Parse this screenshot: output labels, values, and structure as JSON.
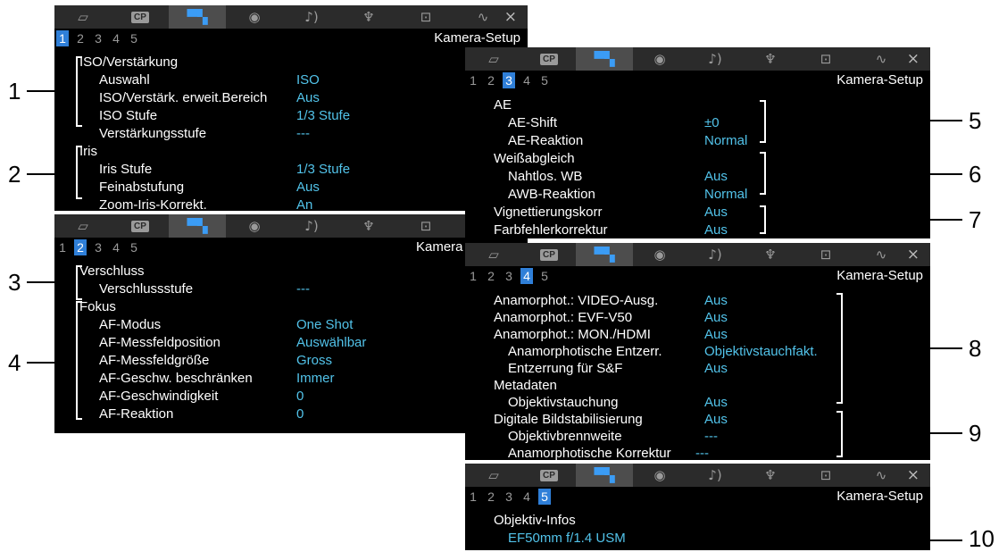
{
  "icons": [
    "frame-icon",
    "cp-icon",
    "camera-icon",
    "color-wheel-icon",
    "audio-icon",
    "wrench-icon",
    "custom-icon",
    "wave-icon",
    "close-icon"
  ],
  "cp_label": "CP",
  "close_glyph": "×",
  "selected_icon": "camera-icon",
  "page_title": "Kamera-Setup",
  "tab_numbers": [
    "1",
    "2",
    "3",
    "4",
    "5"
  ],
  "panels": {
    "p1": {
      "selected_tab": "1",
      "title": "Kamera-Setup",
      "groups": [
        {
          "label": "ISO/Verstärkung",
          "items": [
            {
              "label": "Auswahl",
              "value": "ISO"
            },
            {
              "label": "ISO/Verstärk. erweit.Bereich",
              "value": "Aus"
            },
            {
              "label": "ISO Stufe",
              "value": "1/3 Stufe"
            },
            {
              "label": "Verstärkungsstufe",
              "value": "---"
            }
          ]
        },
        {
          "label": "Iris",
          "items": [
            {
              "label": "Iris Stufe",
              "value": "1/3 Stufe"
            },
            {
              "label": "Feinabstufung",
              "value": "Aus"
            },
            {
              "label": "Zoom-Iris-Korrekt.",
              "value": "An"
            }
          ]
        }
      ]
    },
    "p2": {
      "selected_tab": "2",
      "title": "Kamera",
      "groups": [
        {
          "label": "Verschluss",
          "items": [
            {
              "label": "Verschlussstufe",
              "value": "---"
            }
          ]
        },
        {
          "label": "Fokus",
          "items": [
            {
              "label": "AF-Modus",
              "value": "One Shot"
            },
            {
              "label": "AF-Messfeldposition",
              "value": "Auswählbar"
            },
            {
              "label": "AF-Messfeldgröße",
              "value": "Gross"
            },
            {
              "label": "AF-Geschw. beschränken",
              "value": "Immer"
            },
            {
              "label": "AF-Geschwindigkeit",
              "value": "0"
            },
            {
              "label": "AF-Reaktion",
              "value": "0"
            }
          ]
        }
      ]
    },
    "p3": {
      "selected_tab": "3",
      "title": "Kamera-Setup",
      "rows": [
        {
          "label": "AE",
          "value": ""
        },
        {
          "label": "AE-Shift",
          "value": "±0"
        },
        {
          "label": "AE-Reaktion",
          "value": "Normal"
        },
        {
          "label": "Weißabgleich",
          "value": ""
        },
        {
          "label": "Nahtlos. WB",
          "value": "Aus"
        },
        {
          "label": "AWB-Reaktion",
          "value": "Normal"
        },
        {
          "label": "Vignettierungskorr",
          "value": "Aus"
        },
        {
          "label": "Farbfehlerkorrektur",
          "value": "Aus"
        }
      ]
    },
    "p4": {
      "selected_tab": "4",
      "title": "Kamera-Setup",
      "rows": [
        {
          "label": "Anamorphot.: VIDEO-Ausg.",
          "value": "Aus"
        },
        {
          "label": "Anamorphot.: EVF-V50",
          "value": "Aus"
        },
        {
          "label": "Anamorphot.: MON./HDMI",
          "value": "Aus"
        },
        {
          "label": "Anamorphotische Entzerr.",
          "value": "Objektivstauchfakt."
        },
        {
          "label": "Entzerrung für S&F",
          "value": "Aus"
        },
        {
          "label": "Metadaten",
          "value": ""
        },
        {
          "label": "Objektivstauchung",
          "value": "Aus"
        },
        {
          "label": "Digitale Bildstabilisierung",
          "value": "Aus"
        },
        {
          "label": "Objektivbrennweite",
          "value": "---"
        },
        {
          "label": "Anamorphotische Korrektur",
          "value": "---"
        }
      ]
    },
    "p5": {
      "selected_tab": "5",
      "title": "Kamera-Setup",
      "rows": [
        {
          "label": "Objektiv-Infos",
          "value": ""
        },
        {
          "label": "",
          "value": "EF50mm f/1.4 USM"
        }
      ]
    }
  },
  "callouts": [
    "1",
    "2",
    "3",
    "4",
    "5",
    "6",
    "7",
    "8",
    "9",
    "10"
  ],
  "colors": {
    "value": "#52c3ea",
    "tab_selected": "#2f7fd8",
    "icon_selected": "#3b9cf5",
    "topbar": "#2b2b2b"
  }
}
